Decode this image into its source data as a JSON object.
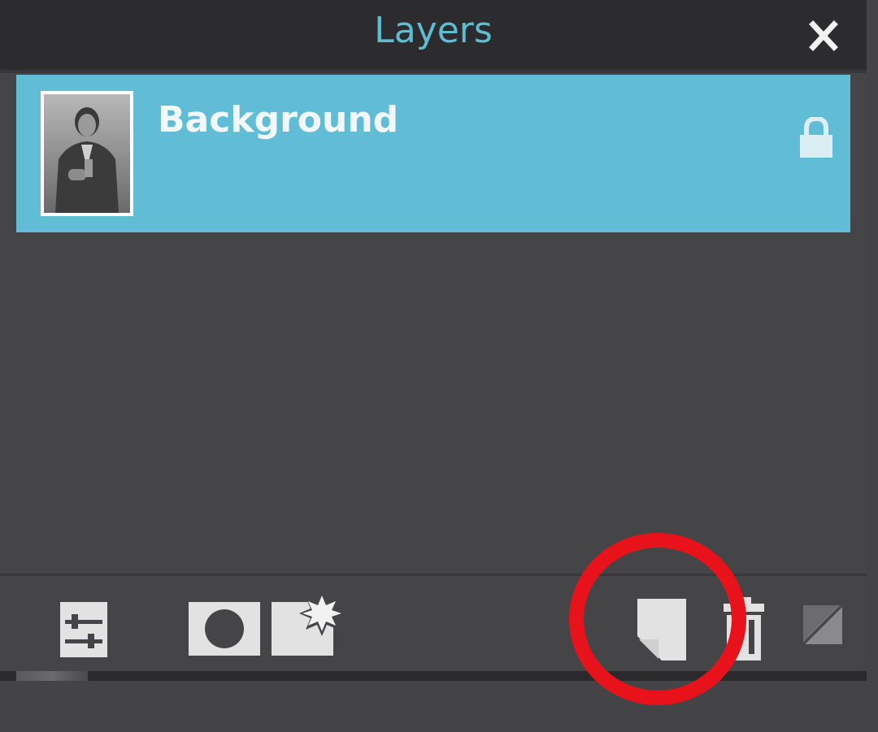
{
  "panel": {
    "title": "Layers",
    "close_icon": "close-icon",
    "accent_color": "#5fbcd3"
  },
  "layers": [
    {
      "name": "Background",
      "locked": true,
      "selected": true,
      "thumbnail_icon": "portrait-photo-thumbnail",
      "lock_icon": "lock-icon",
      "row_color": "#61bcd5"
    }
  ],
  "toolbar": {
    "items": [
      {
        "name": "adjustments-icon"
      },
      {
        "name": "add-mask-icon"
      },
      {
        "name": "layer-effects-icon"
      },
      {
        "name": "new-layer-icon"
      },
      {
        "name": "delete-layer-icon"
      },
      {
        "name": "layer-fill-icon"
      }
    ]
  },
  "annotation": {
    "type": "circle",
    "color": "#e8131a",
    "target": "new-layer-icon"
  }
}
